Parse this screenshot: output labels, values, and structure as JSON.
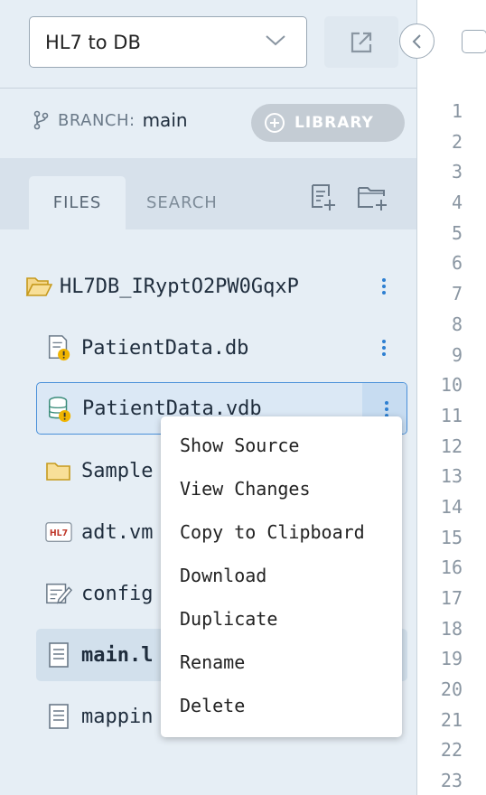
{
  "header": {
    "project_name": "HL7 to DB"
  },
  "branch": {
    "label": "BRANCH:",
    "value": "main"
  },
  "library_button": {
    "label": "LIBRARY"
  },
  "tabs": {
    "files": "FILES",
    "search": "SEARCH"
  },
  "tree": {
    "root": "HL7DB_IRyptO2PW0GqxP",
    "items": [
      {
        "label": "PatientData.db",
        "icon": "db-document-warning-icon"
      },
      {
        "label": "PatientData.vdb",
        "icon": "database-warning-icon"
      },
      {
        "label": "Sample",
        "icon": "folder-icon"
      },
      {
        "label": "adt.vm",
        "icon": "hl7-icon"
      },
      {
        "label": "config",
        "icon": "config-icon"
      },
      {
        "label": "main.l",
        "icon": "document-icon"
      },
      {
        "label": "mappin",
        "icon": "document-icon"
      }
    ]
  },
  "context_menu": {
    "items": [
      "Show Source",
      "View Changes",
      "Copy to Clipboard",
      "Download",
      "Duplicate",
      "Rename",
      "Delete"
    ]
  },
  "editor": {
    "line_numbers": [
      "1",
      "2",
      "3",
      "4",
      "5",
      "6",
      "7",
      "8",
      "9",
      "10",
      "11",
      "12",
      "13",
      "14",
      "15",
      "16",
      "17",
      "18",
      "19",
      "20",
      "21",
      "22",
      "23"
    ]
  },
  "colors": {
    "sidebar_bg": "#e6eef5",
    "accent": "#2d7fd1",
    "warning": "#f0b400",
    "hl7_red": "#c0392b"
  }
}
